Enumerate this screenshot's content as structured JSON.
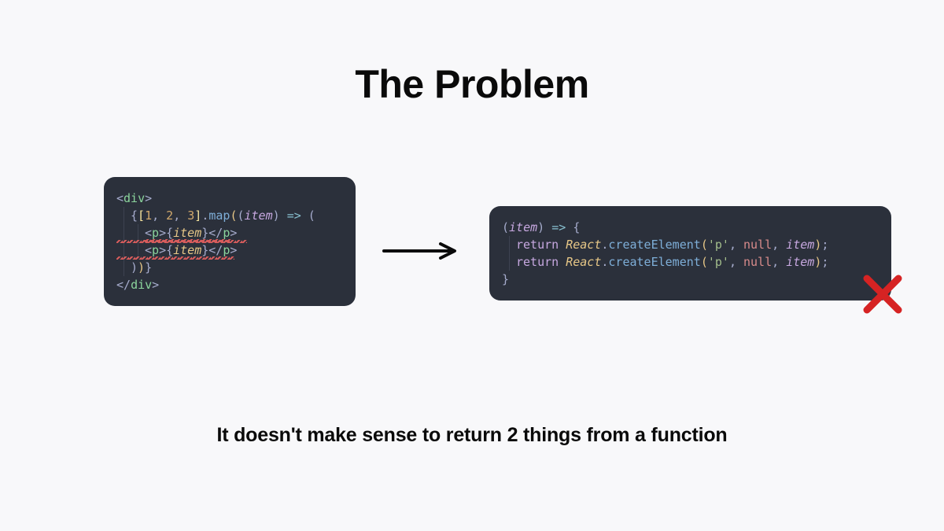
{
  "title": "The Problem",
  "caption": "It doesn't make sense to return 2 things from a function",
  "colors": {
    "bg": "#f8f8fa",
    "card": "#2b303b",
    "error": "#d62323"
  },
  "code_left": {
    "l1": {
      "open": "<",
      "tag": "div",
      "close": ">"
    },
    "l2": {
      "lbrace": "{",
      "lbrack": "[",
      "n1": "1",
      "comma1": ", ",
      "n2": "2",
      "comma2": ", ",
      "n3": "3",
      "rbrack": "]",
      "dot": ".",
      "method": "map",
      "lpar": "(",
      "lpar2": "(",
      "param": "item",
      "rpar2": ")",
      "sp": " ",
      "arrow": "=>",
      "sp2": " ",
      "lpar3": "("
    },
    "l3": {
      "open": "<",
      "tag": "p",
      "close": ">",
      "lbrace": "{",
      "item": "item",
      "rbrace": "}",
      "open2": "</",
      "tag2": "p",
      "close2": ">"
    },
    "l4": {
      "open": "<",
      "tag": "p",
      "close": ">",
      "lbrace": "{",
      "item": "item",
      "rbrace": "}",
      "open2": "</",
      "tag2": "p",
      "close2": ">"
    },
    "l5": {
      "rpar": ")",
      "rpar2": ")",
      "rbrace": "}"
    },
    "l6": {
      "open": "</",
      "tag": "div",
      "close": ">"
    }
  },
  "code_right": {
    "l1": {
      "lpar": "(",
      "param": "item",
      "rpar": ")",
      "sp": " ",
      "arrow": "=>",
      "sp2": " ",
      "lbrace": "{"
    },
    "l2": {
      "kw": "return",
      "sp": " ",
      "cls": "React",
      "dot": ".",
      "method": "createElement",
      "lpar": "(",
      "str": "'p'",
      "c1": ", ",
      "null": "null",
      "c2": ", ",
      "item": "item",
      "rpar": ")",
      "semi": ";"
    },
    "l3": {
      "kw": "return",
      "sp": " ",
      "cls": "React",
      "dot": ".",
      "method": "createElement",
      "lpar": "(",
      "str": "'p'",
      "c1": ", ",
      "null": "null",
      "c2": ", ",
      "item": "item",
      "rpar": ")",
      "semi": ";"
    },
    "l4": {
      "rbrace": "}"
    }
  }
}
